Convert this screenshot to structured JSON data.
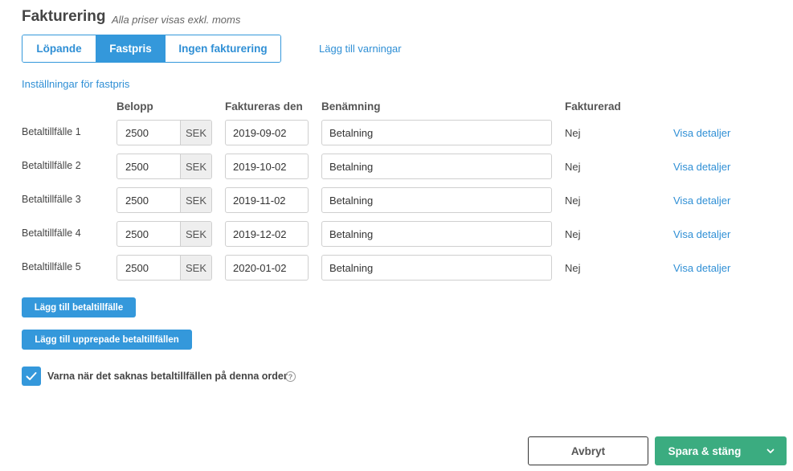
{
  "header": {
    "title": "Fakturering",
    "subtitle": "Alla priser visas exkl. moms"
  },
  "billing_mode": {
    "options": [
      "Löpande",
      "Fastpris",
      "Ingen fakturering"
    ],
    "selected": "Fastpris"
  },
  "warnings_link": "Lägg till varningar",
  "settings_link": "Inställningar för fastpris",
  "table": {
    "columns": [
      "Belopp",
      "Faktureras den",
      "Benämning",
      "Fakturerad"
    ],
    "rows": [
      {
        "label": "Betaltillfälle 1",
        "amount": "2500",
        "currency": "SEK",
        "date": "2019-09-02",
        "name": "Betalning",
        "invoiced": "Nej",
        "details": "Visa detaljer"
      },
      {
        "label": "Betaltillfälle 2",
        "amount": "2500",
        "currency": "SEK",
        "date": "2019-10-02",
        "name": "Betalning",
        "invoiced": "Nej",
        "details": "Visa detaljer"
      },
      {
        "label": "Betaltillfälle 3",
        "amount": "2500",
        "currency": "SEK",
        "date": "2019-11-02",
        "name": "Betalning",
        "invoiced": "Nej",
        "details": "Visa detaljer"
      },
      {
        "label": "Betaltillfälle 4",
        "amount": "2500",
        "currency": "SEK",
        "date": "2019-12-02",
        "name": "Betalning",
        "invoiced": "Nej",
        "details": "Visa detaljer"
      },
      {
        "label": "Betaltillfälle 5",
        "amount": "2500",
        "currency": "SEK",
        "date": "2020-01-02",
        "name": "Betalning",
        "invoiced": "Nej",
        "details": "Visa detaljer"
      }
    ]
  },
  "buttons": {
    "add_payment": "Lägg till betaltillfälle",
    "add_recurring": "Lägg till upprepade betaltillfällen",
    "cancel": "Avbryt",
    "save_close": "Spara & stäng"
  },
  "warn_checkbox": {
    "label": "Varna när det saknas betaltillfällen på denna order",
    "checked": true,
    "help_icon": "?"
  },
  "colors": {
    "accent": "#3498db",
    "save": "#3bac80"
  },
  "icons": {
    "checkbox": "check-icon",
    "help": "help-circle-icon",
    "save_dropdown": "chevron-down-icon"
  }
}
